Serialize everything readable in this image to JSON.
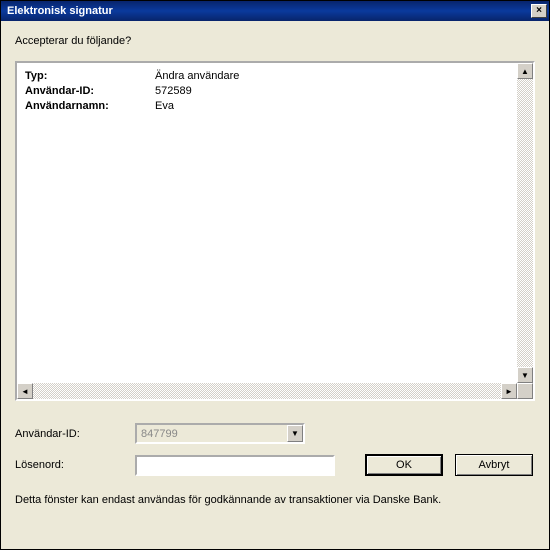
{
  "titlebar": {
    "title": "Elektronisk signatur",
    "close": "×"
  },
  "prompt": "Accepterar du följande?",
  "details": {
    "rows": [
      {
        "label": "Typ:",
        "value": "Ändra användare"
      },
      {
        "label": "Användar-ID:",
        "value": "572589"
      },
      {
        "label": "Användarnamn:",
        "value": "Eva"
      }
    ]
  },
  "form": {
    "user_id_label": "Användar-ID:",
    "user_id_value": "847799",
    "password_label": "Lösenord:",
    "password_value": "",
    "ok_label": "OK",
    "cancel_label": "Avbryt"
  },
  "footer": "Detta fönster kan endast användas för godkännande av transaktioner via Danske Bank.",
  "glyphs": {
    "arrow_up": "▲",
    "arrow_down": "▼",
    "arrow_left": "◄",
    "arrow_right": "►"
  }
}
